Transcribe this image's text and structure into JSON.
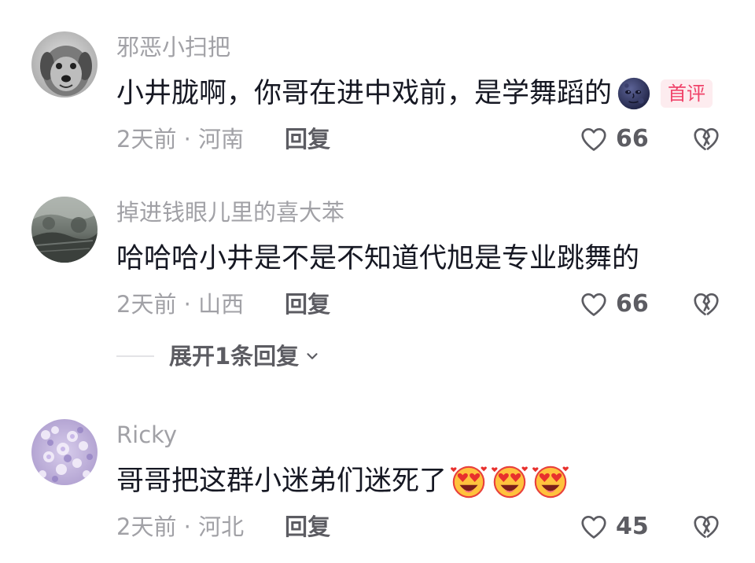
{
  "comments": [
    {
      "avatar": "dog-photo-avatar",
      "username": "邪恶小扫把",
      "content": "小井胧啊，你哥在进中戏前，是学舞蹈的",
      "emoji": [
        "moon-face"
      ],
      "badge": "首评",
      "meta": "2天前 · 河南",
      "reply_label": "回复",
      "likes": "66"
    },
    {
      "avatar": "landscape-photo-avatar",
      "username": "掉进钱眼儿里的喜大苯",
      "content": "哈哈哈小井是不是不知道代旭是专业跳舞的",
      "meta": "2天前 · 山西",
      "reply_label": "回复",
      "likes": "66"
    },
    {
      "avatar": "lavender-flowers-avatar",
      "username": "Ricky",
      "content": "哥哥把这群小迷弟们迷死了",
      "emoji": [
        "heart-eyes-face",
        "heart-eyes-face",
        "heart-eyes-face"
      ],
      "meta": "2天前 · 河北",
      "reply_label": "回复",
      "likes": "45"
    }
  ],
  "expand_replies": {
    "label": "展开1条回复",
    "icon": "chevron-down-icon"
  },
  "icons": {
    "like": "heart-outline-icon",
    "dislike": "broken-heart-icon"
  },
  "colors": {
    "text_primary": "#161823",
    "text_secondary": "#a1a1a6",
    "action_text": "#5c5c62",
    "badge_text": "#f0436a",
    "badge_bg": "#fdecef"
  }
}
